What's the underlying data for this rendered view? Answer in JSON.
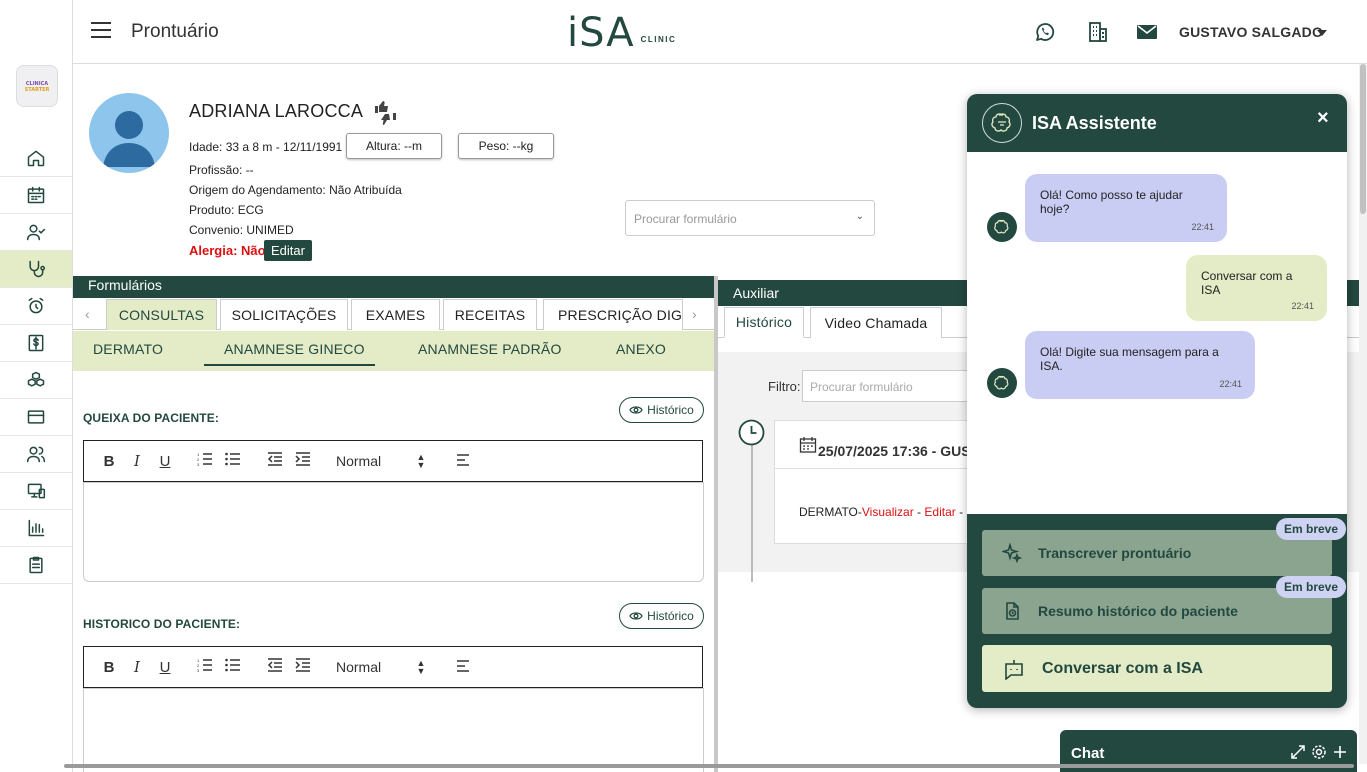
{
  "header": {
    "page_title": "Prontuário",
    "brand": "iSA",
    "brand_sub": "CLINIC",
    "user_name": "GUSTAVO SALGADO"
  },
  "sidebar": {
    "logo_text": "CLINICA STARTER",
    "items": [
      {
        "icon": "home-icon"
      },
      {
        "icon": "calendar-icon"
      },
      {
        "icon": "user-check-icon"
      },
      {
        "icon": "stethoscope-icon",
        "active": true
      },
      {
        "icon": "alarm-icon"
      },
      {
        "icon": "dollar-icon"
      },
      {
        "icon": "boxes-icon"
      },
      {
        "icon": "credit-card-icon"
      },
      {
        "icon": "users-icon"
      },
      {
        "icon": "devices-icon"
      },
      {
        "icon": "bar-chart-icon"
      },
      {
        "icon": "clipboard-icon"
      }
    ]
  },
  "patient": {
    "name": "ADRIANA LAROCCA",
    "idade": "Idade: 33 a 8 m - 12/11/1991",
    "altura": "Altura: --m",
    "peso": "Peso: --kg",
    "profissao": "Profissão: --",
    "origem_label": "Origem do Agendamento:",
    "origem_value": "Não Atribuída",
    "produto": "Produto: ECG",
    "convenio": "Convenio: UNIMED",
    "alergia": "Alergia: Não",
    "edit_label": "Editar"
  },
  "form_search": {
    "placeholder": "Procurar formulário"
  },
  "formularios": {
    "title": "Formulários",
    "tabs": [
      "CONSULTAS",
      "SOLICITAÇÕES",
      "EXAMES",
      "RECEITAS",
      "PRESCRIÇÃO DIGIT."
    ],
    "subtabs": [
      "DERMATO",
      "ANAMNESE GINECO",
      "ANAMNESE PADRÃO",
      "ANEXO"
    ],
    "sections": [
      {
        "label": "QUEIXA DO PACIENTE:",
        "history_button": "Histórico"
      },
      {
        "label": "HISTORICO DO PACIENTE:",
        "history_button": "Histórico"
      }
    ],
    "toolbar": {
      "bold": "B",
      "italic": "I",
      "underline": "U",
      "format": "Normal"
    }
  },
  "auxiliar": {
    "title": "Auxiliar",
    "tabs": [
      "Histórico",
      "Video Chamada"
    ],
    "filter_label": "Filtro:",
    "filter_placeholder": "Procurar formulário",
    "entry_date": "25/07/2025 17:36 - GUS",
    "entry_type": "DERMATO-",
    "entry_view": "Visualizar",
    "entry_edit": "Editar",
    "sep": "-"
  },
  "assistant": {
    "title": "ISA Assistente",
    "close": "×",
    "messages": [
      {
        "from": "bot",
        "text": "Olá! Como posso te ajudar hoje?",
        "time": "22:41"
      },
      {
        "from": "user",
        "text": "Conversar com a ISA",
        "time": "22:41"
      },
      {
        "from": "bot",
        "text": "Olá! Digite sua mensagem para a ISA.",
        "time": "22:41"
      }
    ],
    "actions": [
      {
        "label": "Transcrever prontuário",
        "badge": "Em breve"
      },
      {
        "label": "Resumo histórico do paciente",
        "badge": "Em breve"
      }
    ],
    "talk_button": "Conversar com a ISA"
  },
  "chat": {
    "title": "Chat"
  },
  "colors": {
    "primary": "#23483f",
    "accent_light": "#e3ebc7",
    "bot_bubble": "#c9cdf3",
    "user_bubble": "#e3ebc7",
    "alert": "#dd1111"
  }
}
